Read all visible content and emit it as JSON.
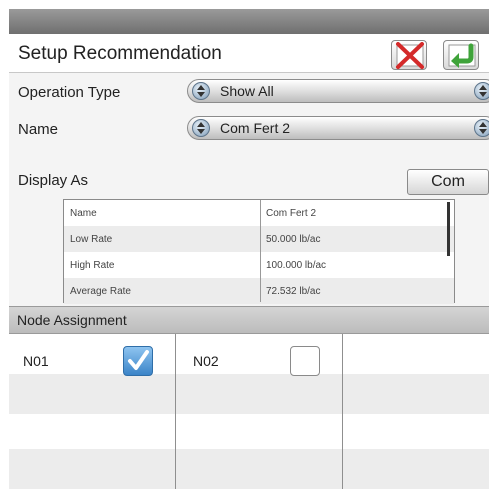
{
  "title": "Setup Recommendation",
  "icons": {
    "cancel": "cancel-x-icon",
    "accept": "accept-arrow-icon"
  },
  "fields": {
    "operation_type": {
      "label": "Operation Type",
      "value": "Show All"
    },
    "name": {
      "label": "Name",
      "value": "Com Fert 2"
    },
    "display_as": {
      "label": "Display As",
      "button": "Com"
    }
  },
  "details": [
    {
      "key": "Name",
      "value": "Com Fert 2"
    },
    {
      "key": "Low Rate",
      "value": "50.000 lb/ac"
    },
    {
      "key": "High Rate",
      "value": "100.000 lb/ac"
    },
    {
      "key": "Average Rate",
      "value": "72.532 lb/ac"
    }
  ],
  "node_assignment": {
    "title": "Node Assignment",
    "nodes": [
      {
        "label": "N01",
        "checked": true
      },
      {
        "label": "N02",
        "checked": false
      }
    ]
  },
  "colors": {
    "cancel_red": "#d42a2a",
    "accept_green": "#3fa33a",
    "checkbox_blue": "#3b84c8"
  }
}
